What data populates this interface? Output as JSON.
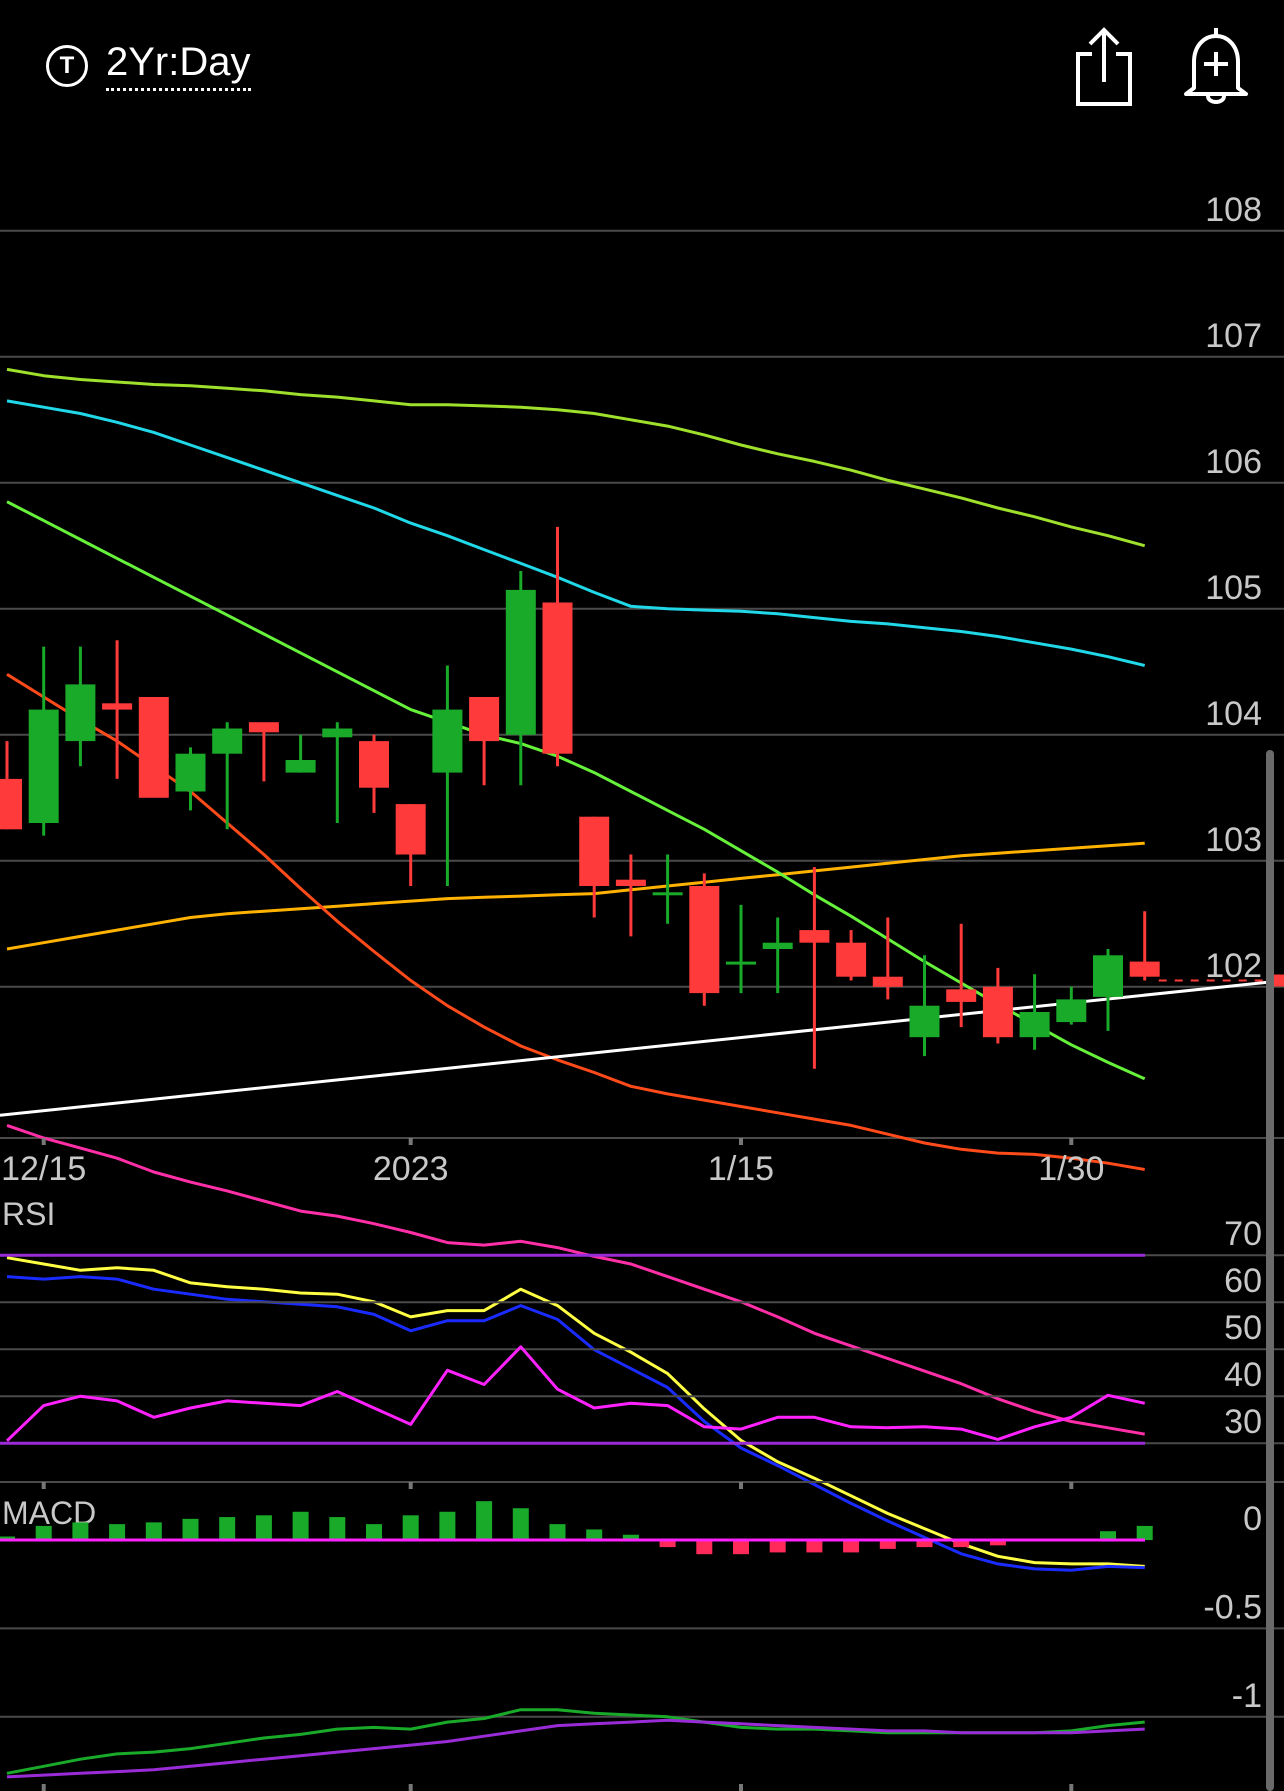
{
  "header": {
    "period_label": "2Yr:Day",
    "period_icon": "T",
    "share_icon": "share-icon",
    "alert_icon": "bell-plus-icon"
  },
  "chart_data": {
    "type": "candlestick",
    "x_tick_labels": [
      "12/15",
      "2023",
      "1/15",
      "1/30"
    ],
    "price_axis": {
      "ylim": [
        100.8,
        108.8
      ],
      "ticks": [
        108,
        107,
        106,
        105,
        104,
        103,
        102
      ]
    },
    "candles": [
      {
        "o": 103.65,
        "h": 103.95,
        "l": 103.25,
        "c": 103.25
      },
      {
        "o": 103.3,
        "h": 104.7,
        "l": 103.2,
        "c": 104.2
      },
      {
        "o": 103.95,
        "h": 104.7,
        "l": 103.75,
        "c": 104.4
      },
      {
        "o": 104.25,
        "h": 104.75,
        "l": 103.65,
        "c": 104.2
      },
      {
        "o": 104.3,
        "h": 104.3,
        "l": 103.58,
        "c": 103.5
      },
      {
        "o": 103.55,
        "h": 103.9,
        "l": 103.4,
        "c": 103.85
      },
      {
        "o": 103.85,
        "h": 104.1,
        "l": 103.25,
        "c": 104.05
      },
      {
        "o": 104.1,
        "h": 104.05,
        "l": 103.63,
        "c": 104.02
      },
      {
        "o": 103.7,
        "h": 104.0,
        "l": 103.7,
        "c": 103.8
      },
      {
        "o": 103.98,
        "h": 104.1,
        "l": 103.3,
        "c": 104.05
      },
      {
        "o": 103.95,
        "h": 104.0,
        "l": 103.38,
        "c": 103.58
      },
      {
        "o": 103.45,
        "h": 103.45,
        "l": 102.8,
        "c": 103.05
      },
      {
        "o": 103.7,
        "h": 104.55,
        "l": 102.8,
        "c": 104.2
      },
      {
        "o": 104.3,
        "h": 104.3,
        "l": 103.6,
        "c": 103.95
      },
      {
        "o": 104.0,
        "h": 105.3,
        "l": 103.6,
        "c": 105.15
      },
      {
        "o": 105.05,
        "h": 105.65,
        "l": 103.75,
        "c": 103.85
      },
      {
        "o": 103.35,
        "h": 103.35,
        "l": 102.55,
        "c": 102.8
      },
      {
        "o": 102.85,
        "h": 103.05,
        "l": 102.4,
        "c": 102.8
      },
      {
        "o": 102.75,
        "h": 103.05,
        "l": 102.5,
        "c": 102.75
      },
      {
        "o": 102.8,
        "h": 102.9,
        "l": 101.85,
        "c": 101.95
      },
      {
        "o": 102.2,
        "h": 102.65,
        "l": 101.95,
        "c": 102.2
      },
      {
        "o": 102.3,
        "h": 102.55,
        "l": 101.95,
        "c": 102.35
      },
      {
        "o": 102.45,
        "h": 102.95,
        "l": 101.35,
        "c": 102.35
      },
      {
        "o": 102.35,
        "h": 102.45,
        "l": 102.05,
        "c": 102.08
      },
      {
        "o": 102.08,
        "h": 102.55,
        "l": 101.9,
        "c": 102.0
      },
      {
        "o": 101.6,
        "h": 102.25,
        "l": 101.45,
        "c": 101.85
      },
      {
        "o": 101.98,
        "h": 102.5,
        "l": 101.68,
        "c": 101.88
      },
      {
        "o": 102.0,
        "h": 102.15,
        "l": 101.55,
        "c": 101.6
      },
      {
        "o": 101.6,
        "h": 102.1,
        "l": 101.5,
        "c": 101.8
      },
      {
        "o": 101.72,
        "h": 102.0,
        "l": 101.7,
        "c": 101.9
      },
      {
        "o": 101.92,
        "h": 102.3,
        "l": 101.65,
        "c": 102.25
      },
      {
        "o": 102.2,
        "h": 102.6,
        "l": 102.05,
        "c": 102.08
      }
    ],
    "moving_averages": [
      {
        "color": "#9ee02c",
        "values": [
          106.9,
          106.85,
          106.82,
          106.8,
          106.78,
          106.77,
          106.75,
          106.73,
          106.7,
          106.68,
          106.65,
          106.62,
          106.62,
          106.61,
          106.6,
          106.58,
          106.55,
          106.5,
          106.45,
          106.38,
          106.3,
          106.23,
          106.17,
          106.1,
          106.02,
          105.95,
          105.88,
          105.8,
          105.73,
          105.65,
          105.58,
          105.5
        ]
      },
      {
        "color": "#20d8e8",
        "values": [
          106.65,
          106.6,
          106.55,
          106.48,
          106.4,
          106.3,
          106.2,
          106.1,
          106.0,
          105.9,
          105.8,
          105.68,
          105.58,
          105.47,
          105.36,
          105.25,
          105.13,
          105.02,
          105.0,
          104.99,
          104.98,
          104.96,
          104.93,
          104.9,
          104.88,
          104.85,
          104.82,
          104.78,
          104.73,
          104.68,
          104.62,
          104.55
        ]
      },
      {
        "color": "#ffb300",
        "values": [
          102.3,
          102.35,
          102.4,
          102.45,
          102.5,
          102.55,
          102.58,
          102.6,
          102.62,
          102.64,
          102.66,
          102.68,
          102.7,
          102.71,
          102.72,
          102.73,
          102.74,
          102.77,
          102.8,
          102.83,
          102.86,
          102.89,
          102.92,
          102.95,
          102.98,
          103.01,
          103.04,
          103.06,
          103.08,
          103.1,
          103.12,
          103.14
        ]
      },
      {
        "color": "#66f23a",
        "values": [
          105.85,
          105.7,
          105.55,
          105.4,
          105.25,
          105.1,
          104.95,
          104.8,
          104.65,
          104.5,
          104.35,
          104.2,
          104.1,
          104.0,
          103.93,
          103.83,
          103.7,
          103.55,
          103.4,
          103.25,
          103.08,
          102.91,
          102.73,
          102.56,
          102.38,
          102.2,
          102.03,
          101.86,
          101.7,
          101.54,
          101.4,
          101.27
        ]
      },
      {
        "color": "#ff4a1a",
        "values": [
          104.48,
          104.3,
          104.12,
          103.95,
          103.75,
          103.55,
          103.3,
          103.05,
          102.78,
          102.52,
          102.28,
          102.05,
          101.85,
          101.68,
          101.53,
          101.42,
          101.32,
          101.21,
          101.15,
          101.1,
          101.05,
          101.0,
          100.95,
          100.9,
          100.83,
          100.76,
          100.71,
          100.68,
          100.67,
          100.64,
          100.6,
          100.55
        ]
      },
      {
        "color": "#ff2fa8",
        "values": [
          100.9,
          100.8,
          100.72,
          100.64,
          100.53,
          100.45,
          100.38,
          100.3,
          100.22,
          100.18,
          100.12,
          100.05,
          99.97,
          99.95,
          99.98,
          99.93,
          99.86,
          99.8,
          99.7,
          99.6,
          99.5,
          99.38,
          99.25,
          99.15,
          99.05,
          98.95,
          98.85,
          98.73,
          98.63,
          98.55,
          98.5,
          98.45
        ]
      },
      {
        "color": "#ffff44",
        "values": [
          99.85,
          99.8,
          99.75,
          99.77,
          99.75,
          99.65,
          99.62,
          99.6,
          99.57,
          99.56,
          99.5,
          99.38,
          99.43,
          99.43,
          99.6,
          99.47,
          99.25,
          99.1,
          98.93,
          98.65,
          98.4,
          98.23,
          98.1,
          97.96,
          97.82,
          97.7,
          97.58,
          97.48,
          97.43,
          97.42,
          97.42,
          97.4
        ]
      },
      {
        "color": "#1a2bff",
        "values": [
          99.7,
          99.68,
          99.7,
          99.68,
          99.6,
          99.56,
          99.52,
          99.5,
          99.48,
          99.46,
          99.4,
          99.27,
          99.35,
          99.35,
          99.47,
          99.36,
          99.12,
          98.97,
          98.82,
          98.55,
          98.34,
          98.2,
          98.05,
          97.9,
          97.76,
          97.63,
          97.5,
          97.42,
          97.38,
          97.37,
          97.4,
          97.39
        ]
      }
    ],
    "trendline": {
      "start": 100.98,
      "end": 102.05,
      "color": "#ffffff"
    },
    "last_price": 102.05,
    "indicators": [
      {
        "name": "RSI",
        "levels": [
          70,
          60,
          50,
          40,
          30
        ],
        "bands": [
          70,
          30
        ],
        "ylim": [
          26,
          76
        ],
        "line_color": "#ff22ff",
        "band_color": "#9a2cd8",
        "values": [
          30.5,
          38,
          40,
          39,
          35.5,
          37.5,
          39,
          38.5,
          38,
          41,
          37.5,
          34,
          45.5,
          42.5,
          50.5,
          41.5,
          37.5,
          38.5,
          38,
          33.5,
          33,
          35.5,
          35.5,
          33.5,
          33.3,
          33.5,
          33,
          30.8,
          33.5,
          35.5,
          40.2,
          38.5
        ]
      },
      {
        "name": "MACD",
        "levels": [
          0,
          -0.5,
          -1
        ],
        "ylim": [
          -1.42,
          0.17
        ],
        "histogram": [
          0.02,
          0.08,
          0.1,
          0.09,
          0.1,
          0.12,
          0.13,
          0.14,
          0.16,
          0.13,
          0.09,
          0.14,
          0.16,
          0.22,
          0.18,
          0.09,
          0.06,
          0.03,
          -0.04,
          -0.08,
          -0.08,
          -0.07,
          -0.07,
          -0.07,
          -0.05,
          -0.04,
          -0.04,
          -0.03,
          0.0,
          0.0,
          0.05,
          0.08
        ],
        "hist_pos_color": "#1aaa2a",
        "hist_neg_color": "#ff2a5a",
        "zero_line_color": "#ff22ff",
        "macd_line": {
          "color": "#1aaa2a",
          "values": [
            -1.32,
            -1.28,
            -1.24,
            -1.21,
            -1.2,
            -1.18,
            -1.15,
            -1.12,
            -1.1,
            -1.07,
            -1.06,
            -1.07,
            -1.03,
            -1.01,
            -0.96,
            -0.96,
            -0.98,
            -0.99,
            -1.0,
            -1.03,
            -1.06,
            -1.07,
            -1.07,
            -1.08,
            -1.09,
            -1.09,
            -1.09,
            -1.09,
            -1.09,
            -1.08,
            -1.05,
            -1.03
          ]
        },
        "signal_line": {
          "color": "#9a2cd8",
          "values": [
            -1.34,
            -1.33,
            -1.32,
            -1.31,
            -1.3,
            -1.28,
            -1.26,
            -1.24,
            -1.22,
            -1.2,
            -1.18,
            -1.16,
            -1.14,
            -1.11,
            -1.08,
            -1.05,
            -1.04,
            -1.03,
            -1.02,
            -1.03,
            -1.04,
            -1.05,
            -1.06,
            -1.07,
            -1.08,
            -1.08,
            -1.09,
            -1.09,
            -1.09,
            -1.09,
            -1.08,
            -1.07
          ]
        }
      }
    ]
  },
  "colors": {
    "background": "#000000",
    "grid": "#4a4a4a",
    "up_candle": "#1aaa2a",
    "down_candle": "#ff3a3a",
    "axis_label": "#c8c8c8"
  }
}
